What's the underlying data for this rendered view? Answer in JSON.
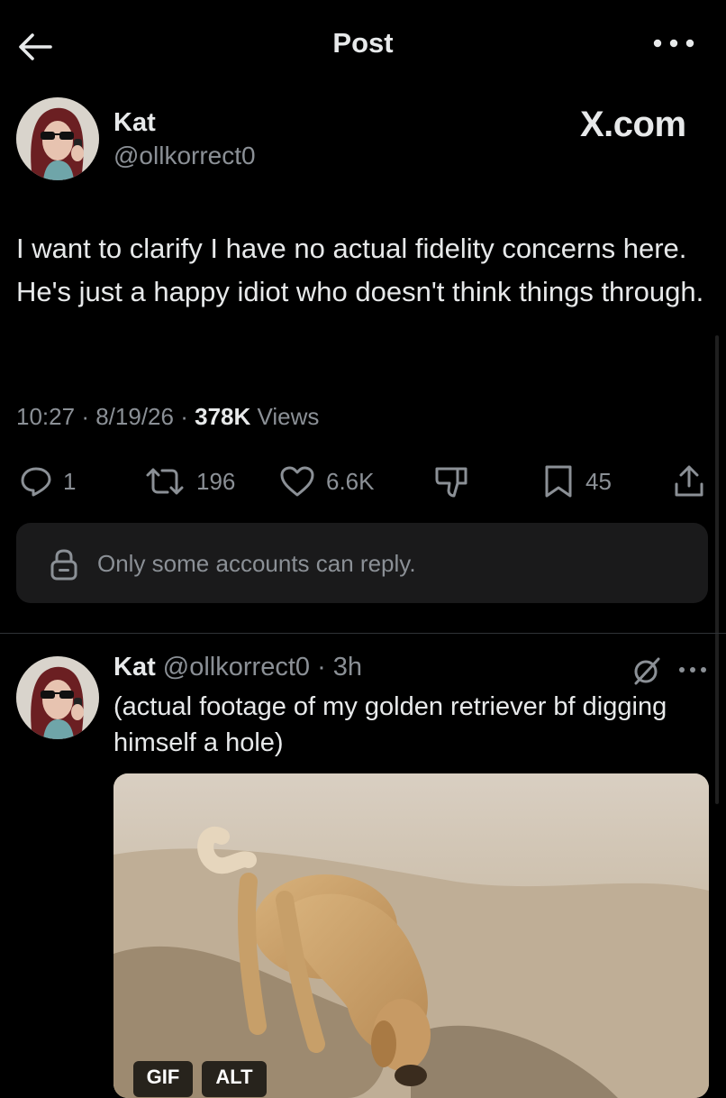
{
  "header": {
    "title": "Post",
    "back_icon": "arrow-left-icon",
    "more_icon": "more-horizontal-icon"
  },
  "tweet": {
    "author_name": "Kat",
    "author_handle": "@ollkorrect0",
    "brand_label": "X.com",
    "text": "I want to clarify I have no actual fidelity concerns here. He's just a happy idiot who doesn't think things through.",
    "time": "10:27",
    "date": "8/19/26",
    "sep": "·",
    "views_count": "378K",
    "views_label": "Views",
    "actions": {
      "replies": "1",
      "reposts": "196",
      "likes": "6.6K",
      "bookmarks": "45"
    },
    "reply_restriction": "Only some accounts can reply."
  },
  "quoted": {
    "author_name": "Kat",
    "author_handle": "@ollkorrect0",
    "age": "· 3h",
    "text": "(actual footage of my golden retriever bf digging himself a hole)",
    "media": {
      "description_icon": "beach-dog-photo",
      "badges": [
        "GIF",
        "ALT"
      ]
    }
  },
  "colors": {
    "background": "#000000",
    "text_primary": "#e7e9ea",
    "text_secondary": "#8b9096",
    "panel": "#1a1a1b",
    "divider": "#2f3336"
  }
}
